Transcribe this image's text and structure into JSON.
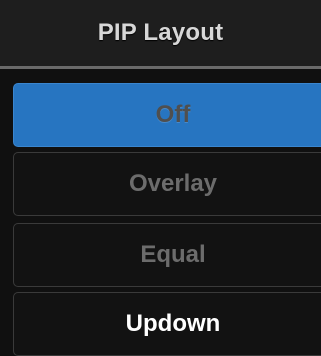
{
  "header": {
    "title": "PIP Layout"
  },
  "colors": {
    "selected_background": "#2775c1",
    "panel_background": "#101010",
    "header_background": "#1e1e1e",
    "divider": "#6a6a6a"
  },
  "options": [
    {
      "label": "Off",
      "state": "selected"
    },
    {
      "label": "Overlay",
      "state": "dimmed"
    },
    {
      "label": "Equal",
      "state": "dimmed"
    },
    {
      "label": "Updown",
      "state": "highlighted-text"
    }
  ]
}
